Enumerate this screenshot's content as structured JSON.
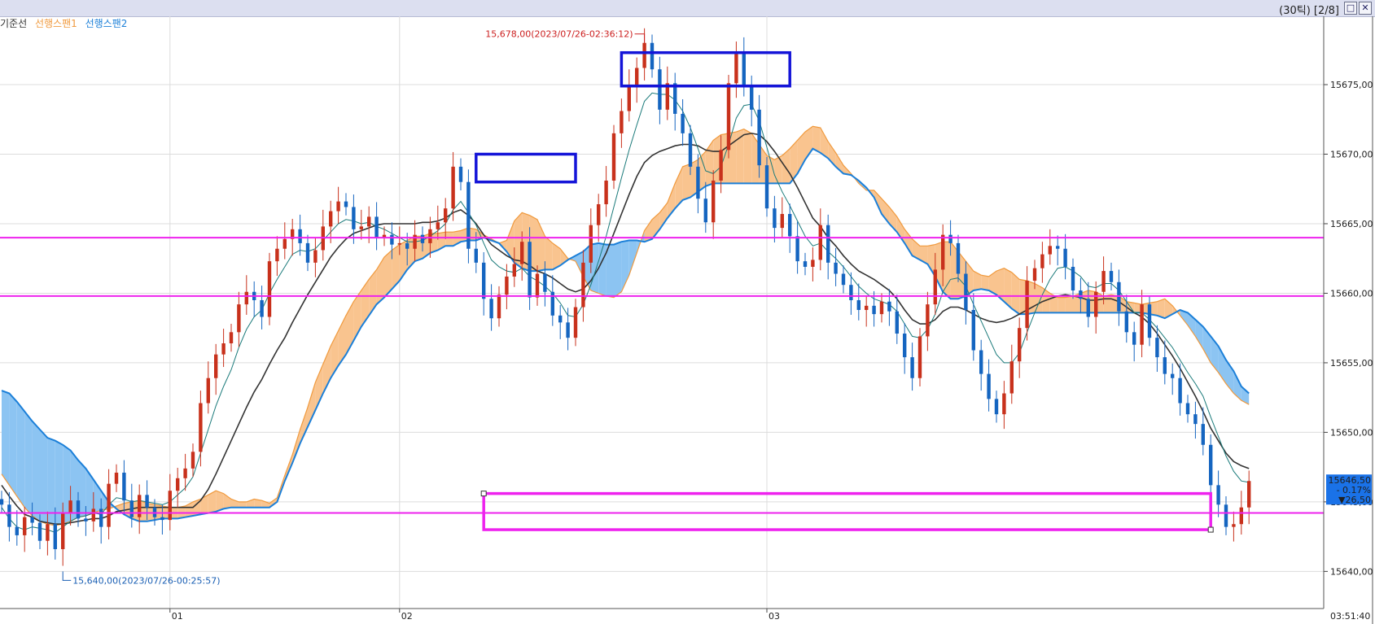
{
  "window": {
    "info": "(30틱) [2/8]",
    "buttons": [
      "□",
      "✕"
    ]
  },
  "legend": [
    {
      "label": "기준선",
      "color": "#333333"
    },
    {
      "label": "선행스팬1",
      "color": "#f09a3e"
    },
    {
      "label": "선행스팬2",
      "color": "#1b7fd8"
    }
  ],
  "chart_data": {
    "type": "candlestick",
    "ylim": [
      15638.5,
      15680.5
    ],
    "y_ticks": [
      "15640,00",
      "15645,00",
      "15650,00",
      "15655,00",
      "15660,00",
      "15665,00",
      "15670,00",
      "15675,00"
    ],
    "x_ticks": [
      {
        "label": "01",
        "i": 22
      },
      {
        "label": "02",
        "i": 52
      },
      {
        "label": "03",
        "i": 100
      }
    ],
    "time_label": "03:51:40",
    "grid": true,
    "colors": {
      "up": "#c8311c",
      "down": "#1565c0",
      "kijun": "#333333",
      "tenkan": "#1a7a7a",
      "span1": "#f09a3e",
      "span2": "#1b7fd8",
      "cloud_bull": "#f9c48f",
      "cloud_bear": "#8cc4f2",
      "hlines": "#ee22ee",
      "boxes": "#1414d8",
      "price_box": "#1a72e8"
    },
    "close": [
      15644.8,
      15643.2,
      15642.6,
      15643.9,
      15643.5,
      15642.2,
      15643.4,
      15641.6,
      15644.2,
      15645.1,
      15643.8,
      15643.6,
      15644.5,
      15643.2,
      15646.3,
      15647.1,
      15645.1,
      15643.9,
      15645.5,
      15644.6,
      15643.9,
      15643.7,
      15645.8,
      15646.7,
      15647.4,
      15648.6,
      15652.1,
      15653.9,
      15655.6,
      15656.4,
      15657.2,
      15659.2,
      15660.1,
      15659.5,
      15658.3,
      15662.3,
      15663.2,
      15663.9,
      15664.6,
      15663.6,
      15662.2,
      15663.1,
      15664.8,
      15665.9,
      15666.6,
      15666.2,
      15664.6,
      15664.8,
      15665.5,
      15664.0,
      15664.2,
      15663.5,
      15663.6,
      15663.2,
      15664.2,
      15663.6,
      15664.6,
      15665.1,
      15666.1,
      15669.1,
      15668.0,
      15663.2,
      15662.2,
      15659.6,
      15658.2,
      15659.9,
      15661.2,
      15662.1,
      15663.7,
      15659.7,
      15661.4,
      15660.1,
      15658.4,
      15657.9,
      15656.8,
      15659.0,
      15662.2,
      15664.9,
      15666.4,
      15668.1,
      15671.5,
      15673.1,
      15674.9,
      15676.2,
      15678.0,
      15676.1,
      15673.2,
      15675.1,
      15672.9,
      15671.5,
      15669.1,
      15666.8,
      15665.1,
      15668.1,
      15670.3,
      15675.1,
      15677.2,
      15674.9,
      15673.2,
      15669.2,
      15666.1,
      15664.7,
      15665.7,
      15664.1,
      15662.3,
      15661.9,
      15662.4,
      15664.9,
      15662.2,
      15661.4,
      15660.6,
      15659.5,
      15658.8,
      15659.1,
      15658.5,
      15659.4,
      15658.7,
      15657.1,
      15655.4,
      15653.9,
      15656.9,
      15659.2,
      15661.7,
      15664.2,
      15663.6,
      15661.4,
      15658.8,
      15655.9,
      15654.2,
      15652.4,
      15651.3,
      15652.8,
      15655.1,
      15657.5,
      15660.9,
      15661.8,
      15662.8,
      15663.4,
      15663.2,
      15661.9,
      15660.2,
      15659.6,
      15658.3,
      15660.1,
      15661.6,
      15660.8,
      15658.7,
      15657.2,
      15656.3,
      15659.2,
      15656.8,
      15655.4,
      15654.2,
      15653.9,
      15652.1,
      15651.3,
      15650.6,
      15649.1,
      15646.2,
      15644.8,
      15643.2,
      15643.4,
      15644.6,
      15646.5
    ],
    "tenkan": [
      15644.6,
      15643.8,
      15643.2,
      15643.0,
      15643.2,
      15643.1,
      15643.0,
      15642.8,
      15643.2,
      15643.6,
      15643.9,
      15644.0,
      15644.2,
      15644.1,
      15644.8,
      15645.3,
      15645.2,
      15645.0,
      15645.1,
      15645.0,
      15644.9,
      15644.8,
      15645.0,
      15645.5,
      15646.0,
      15646.8,
      15648.5,
      15650.2,
      15651.9,
      15653.3,
      15654.5,
      15656.1,
      15657.4,
      15658.3,
      15658.8,
      15660.0,
      15661.0,
      15661.9,
      15662.8,
      15663.1,
      15663.0,
      15663.2,
      15663.8,
      15664.4,
      15665.0,
      15665.3,
      15665.2,
      15665.0,
      15665.1,
      15664.8,
      15664.6,
      15664.3,
      15664.0,
      15663.7,
      15663.7,
      15663.8,
      15664.1,
      15664.5,
      15665.0,
      15666.0,
      15666.6,
      15665.8,
      15664.9,
      15663.6,
      15662.4,
      15661.9,
      15661.6,
      15661.5,
      15661.8,
      15661.2,
      15660.9,
      15660.5,
      15660.0,
      15659.3,
      15658.4,
      15658.3,
      15659.2,
      15660.6,
      15662.3,
      15664.1,
      15666.2,
      15668.3,
      15670.3,
      15672.1,
      15673.8,
      15674.4,
      15674.3,
      15674.3,
      15673.9,
      15673.1,
      15671.9,
      15670.4,
      15668.8,
      15668.6,
      15669.1,
      15670.7,
      15672.6,
      15673.5,
      15673.6,
      15672.4,
      15670.5,
      15668.5,
      15667.3,
      15666.3,
      15665.2,
      15664.1,
      15663.4,
      15663.6,
      15663.0,
      15662.5,
      15661.9,
      15661.2,
      15660.5,
      15660.0,
      15659.6,
      15659.4,
      15659.2,
      15658.7,
      15657.8,
      15656.9,
      15656.8,
      15657.4,
      15658.5,
      15660.1,
      15661.0,
      15661.1,
      15660.5,
      15659.2,
      15658.0,
      15656.8,
      15655.6,
      15655.0,
      15655.0,
      15655.7,
      15657.2,
      15658.6,
      15659.9,
      15661.0,
      15661.8,
      15661.9,
      15661.6,
      15661.2,
      15660.5,
      15660.4,
      15660.7,
      15660.7,
      15660.2,
      15659.4,
      15658.6,
      15658.6,
      15658.1,
      15657.5,
      15656.8,
      15656.1,
      15655.2,
      15654.3,
      15653.5,
      15652.6,
      15651.1,
      15649.7,
      15648.3,
      15647.2,
      15646.5,
      15646.4
    ],
    "kijun": [
      15646.2,
      15645.4,
      15644.7,
      15644.1,
      15643.9,
      15643.6,
      15643.5,
      15643.4,
      15643.4,
      15643.5,
      15643.6,
      15643.7,
      15643.8,
      15643.8,
      15644.0,
      15644.3,
      15644.4,
      15644.5,
      15644.6,
      15644.6,
      15644.6,
      15644.6,
      15644.6,
      15644.6,
      15644.6,
      15644.6,
      15645.1,
      15645.9,
      15647.0,
      15648.2,
      15649.4,
      15650.6,
      15651.8,
      15652.9,
      15653.8,
      15654.9,
      15655.9,
      15656.8,
      15657.9,
      15658.9,
      15659.9,
      15660.8,
      15661.7,
      15662.6,
      15663.3,
      15663.9,
      15664.3,
      15664.5,
      15664.7,
      15664.9,
      15665.0,
      15665.0,
      15665.0,
      15665.0,
      15665.0,
      15665.1,
      15665.1,
      15665.2,
      15665.4,
      15665.8,
      15666.0,
      15665.6,
      15665.0,
      15664.2,
      15663.5,
      15663.1,
      15662.7,
      15662.4,
      15662.3,
      15662.0,
      15661.6,
      15661.4,
      15661.1,
      15660.7,
      15660.3,
      15660.1,
      15660.3,
      15660.9,
      15661.8,
      15662.9,
      15664.3,
      15665.7,
      15667.1,
      15668.4,
      15669.4,
      15669.9,
      15670.2,
      15670.4,
      15670.6,
      15670.7,
      15670.7,
      15670.6,
      15670.3,
      15670.2,
      15670.2,
      15670.6,
      15671.0,
      15671.4,
      15671.5,
      15671.4,
      15670.9,
      15670.2,
      15669.4,
      15668.6,
      15667.6,
      15666.5,
      15665.4,
      15664.8,
      15664.0,
      15663.4,
      15662.7,
      15662.1,
      15661.6,
      15661.3,
      15661.0,
      15660.6,
      15660.2,
      15659.6,
      15658.8,
      15658.1,
      15657.8,
      15657.8,
      15658.1,
      15658.7,
      15659.0,
      15659.0,
      15658.8,
      15658.5,
      15658.2,
      15658.0,
      15657.9,
      15658.0,
      15658.2,
      15658.5,
      15658.8,
      15659.1,
      15659.4,
      15659.6,
      15659.8,
      15659.9,
      15659.8,
      15659.7,
      15659.5,
      15659.5,
      15659.6,
      15659.6,
      15659.4,
      15659.0,
      15658.6,
      15658.3,
      15657.8,
      15657.1,
      15656.3,
      15655.5,
      15654.6,
      15653.6,
      15652.6,
      15651.5,
      15650.3,
      15649.4,
      15648.5,
      15647.9,
      15647.6,
      15647.4
    ],
    "span1": [
      15647.0,
      15646.2,
      15645.4,
      15644.6,
      15644.0,
      15643.6,
      15643.4,
      15643.3,
      15643.4,
      15643.6,
      15643.9,
      15644.0,
      15644.2,
      15644.4,
      15644.5,
      15644.7,
      15644.9,
      15645.0,
      15645.1,
      15644.9,
      15644.8,
      15644.7,
      15644.6,
      15644.6,
      15644.7,
      15645.0,
      15645.2,
      15645.5,
      15645.8,
      15645.6,
      15645.2,
      15645.0,
      15645.0,
      15645.2,
      15645.1,
      15644.9,
      15645.3,
      15646.9,
      15648.4,
      15650.2,
      15651.8,
      15653.6,
      15654.9,
      15656.2,
      15657.3,
      15658.4,
      15659.4,
      15660.2,
      15661.0,
      15661.7,
      15662.6,
      15663.1,
      15663.5,
      15663.8,
      15664.1,
      15664.1,
      15664.3,
      15664.3,
      15664.4,
      15664.4,
      15664.5,
      15664.7,
      15664.6,
      15664.2,
      15663.9,
      15663.6,
      15663.8,
      15665.2,
      15665.8,
      15665.6,
      15665.3,
      15664.1,
      15663.6,
      15663.2,
      15662.5,
      15662.3,
      15661.2,
      15660.2,
      15660.0,
      15659.8,
      15659.7,
      15660.1,
      15661.3,
      15662.9,
      15664.5,
      15665.3,
      15665.8,
      15666.5,
      15667.9,
      15669.1,
      15669.3,
      15669.6,
      15670.2,
      15671.0,
      15671.4,
      15671.5,
      15671.6,
      15671.8,
      15671.5,
      15670.7,
      15669.9,
      15669.6,
      15669.9,
      15670.4,
      15671.0,
      15671.6,
      15672.0,
      15671.9,
      15670.9,
      15670.1,
      15669.2,
      15668.6,
      15667.9,
      15667.4,
      15667.4,
      15666.8,
      15666.2,
      15665.5,
      15664.6,
      15663.9,
      15663.4,
      15663.4,
      15663.5,
      15663.7,
      15663.7,
      15663.0,
      15662.3,
      15661.6,
      15661.3,
      15661.2,
      15661.6,
      15661.8,
      15661.5,
      15661.0,
      15660.9,
      15660.7,
      15660.4,
      15660.0,
      15659.7,
      15659.7,
      15659.8,
      15660.0,
      15660.2,
      15660.1,
      15659.8,
      15659.9,
      15659.8,
      15659.4,
      15659.3,
      15659.2,
      15659.3,
      15659.4,
      15659.6,
      15659.1,
      15658.4,
      15657.7,
      15656.9,
      15656.0,
      15655.0,
      15654.3,
      15653.5,
      15652.8,
      15652.3,
      15652.0
    ],
    "span2": [
      15653.0,
      15652.8,
      15652.2,
      15651.5,
      15650.8,
      15650.2,
      15649.6,
      15649.4,
      15649.1,
      15648.7,
      15648.0,
      15647.4,
      15646.6,
      15645.8,
      15645.0,
      15644.5,
      15644.1,
      15643.8,
      15643.6,
      15643.6,
      15643.7,
      15643.8,
      15643.8,
      15643.8,
      15643.9,
      15644.0,
      15644.1,
      15644.2,
      15644.3,
      15644.5,
      15644.6,
      15644.6,
      15644.6,
      15644.6,
      15644.6,
      15644.6,
      15645.0,
      15646.5,
      15647.8,
      15649.2,
      15650.4,
      15651.6,
      15652.8,
      15653.9,
      15654.8,
      15655.6,
      15656.6,
      15657.6,
      15658.4,
      15659.2,
      15659.7,
      15660.3,
      15660.9,
      15661.7,
      15662.3,
      15662.5,
      15662.9,
      15663.1,
      15663.4,
      15663.4,
      15663.7,
      15663.8,
      15663.8,
      15664.0,
      15663.8,
      15663.6,
      15663.0,
      15662.2,
      15661.8,
      15661.6,
      15661.6,
      15661.7,
      15661.7,
      15662.0,
      15662.4,
      15662.7,
      15663.0,
      15663.5,
      15663.6,
      15663.5,
      15663.5,
      15663.7,
      15663.8,
      15663.8,
      15663.7,
      15663.9,
      15664.6,
      15665.4,
      15666.1,
      15666.7,
      15666.9,
      15667.3,
      15667.7,
      15667.9,
      15667.9,
      15667.9,
      15667.9,
      15667.9,
      15667.9,
      15667.9,
      15667.9,
      15667.9,
      15667.9,
      15667.9,
      15668.6,
      15669.6,
      15670.4,
      15670.1,
      15669.7,
      15669.1,
      15668.6,
      15668.5,
      15668.1,
      15667.6,
      15666.9,
      15665.7,
      15665.0,
      15664.4,
      15663.6,
      15662.7,
      15662.4,
      15662.1,
      15661.2,
      15660.1,
      15659.6,
      15659.6,
      15659.8,
      15660.2,
      15660.3,
      15660.2,
      15659.9,
      15659.4,
      15658.9,
      15658.5,
      15658.5,
      15658.6,
      15658.6,
      15658.6,
      15658.6,
      15658.6,
      15658.6,
      15658.6,
      15658.6,
      15658.6,
      15658.6,
      15658.6,
      15658.6,
      15658.6,
      15658.6,
      15658.6,
      15658.5,
      15658.4,
      15658.2,
      15658.5,
      15658.8,
      15658.6,
      15658.1,
      15657.6,
      15656.9,
      15656.2,
      15655.2,
      15654.4,
      15653.3,
      15652.8
    ],
    "n_candles": 155,
    "hlines": [
      15664.0,
      15659.8,
      15644.2
    ],
    "highlight_boxes": [
      {
        "kind": "blue",
        "i0": 62,
        "i1": 75,
        "y_top": 15670.0,
        "y_bottom": 15668.0
      },
      {
        "kind": "blue",
        "i0": 81,
        "i1": 103,
        "y_top": 15677.3,
        "y_bottom": 15674.9
      },
      {
        "kind": "magenta",
        "i0": 63,
        "i1": 158,
        "y_top": 15645.6,
        "y_bottom": 15643.0
      }
    ],
    "annotations": [
      {
        "text": "15,678,00(2023/07/26-02:36:12)",
        "color": "#cc2020",
        "i": 84,
        "y": 15678.0,
        "side": "left"
      },
      {
        "text": "15,640,00(2023/07/26-00:25:57)",
        "color": "#1a5fb4",
        "i": 8,
        "y": 15640.0,
        "side": "right"
      }
    ],
    "last_price": {
      "price": "15646,50",
      "change_pct": "- 0.17%",
      "change": "▼26,50"
    }
  }
}
